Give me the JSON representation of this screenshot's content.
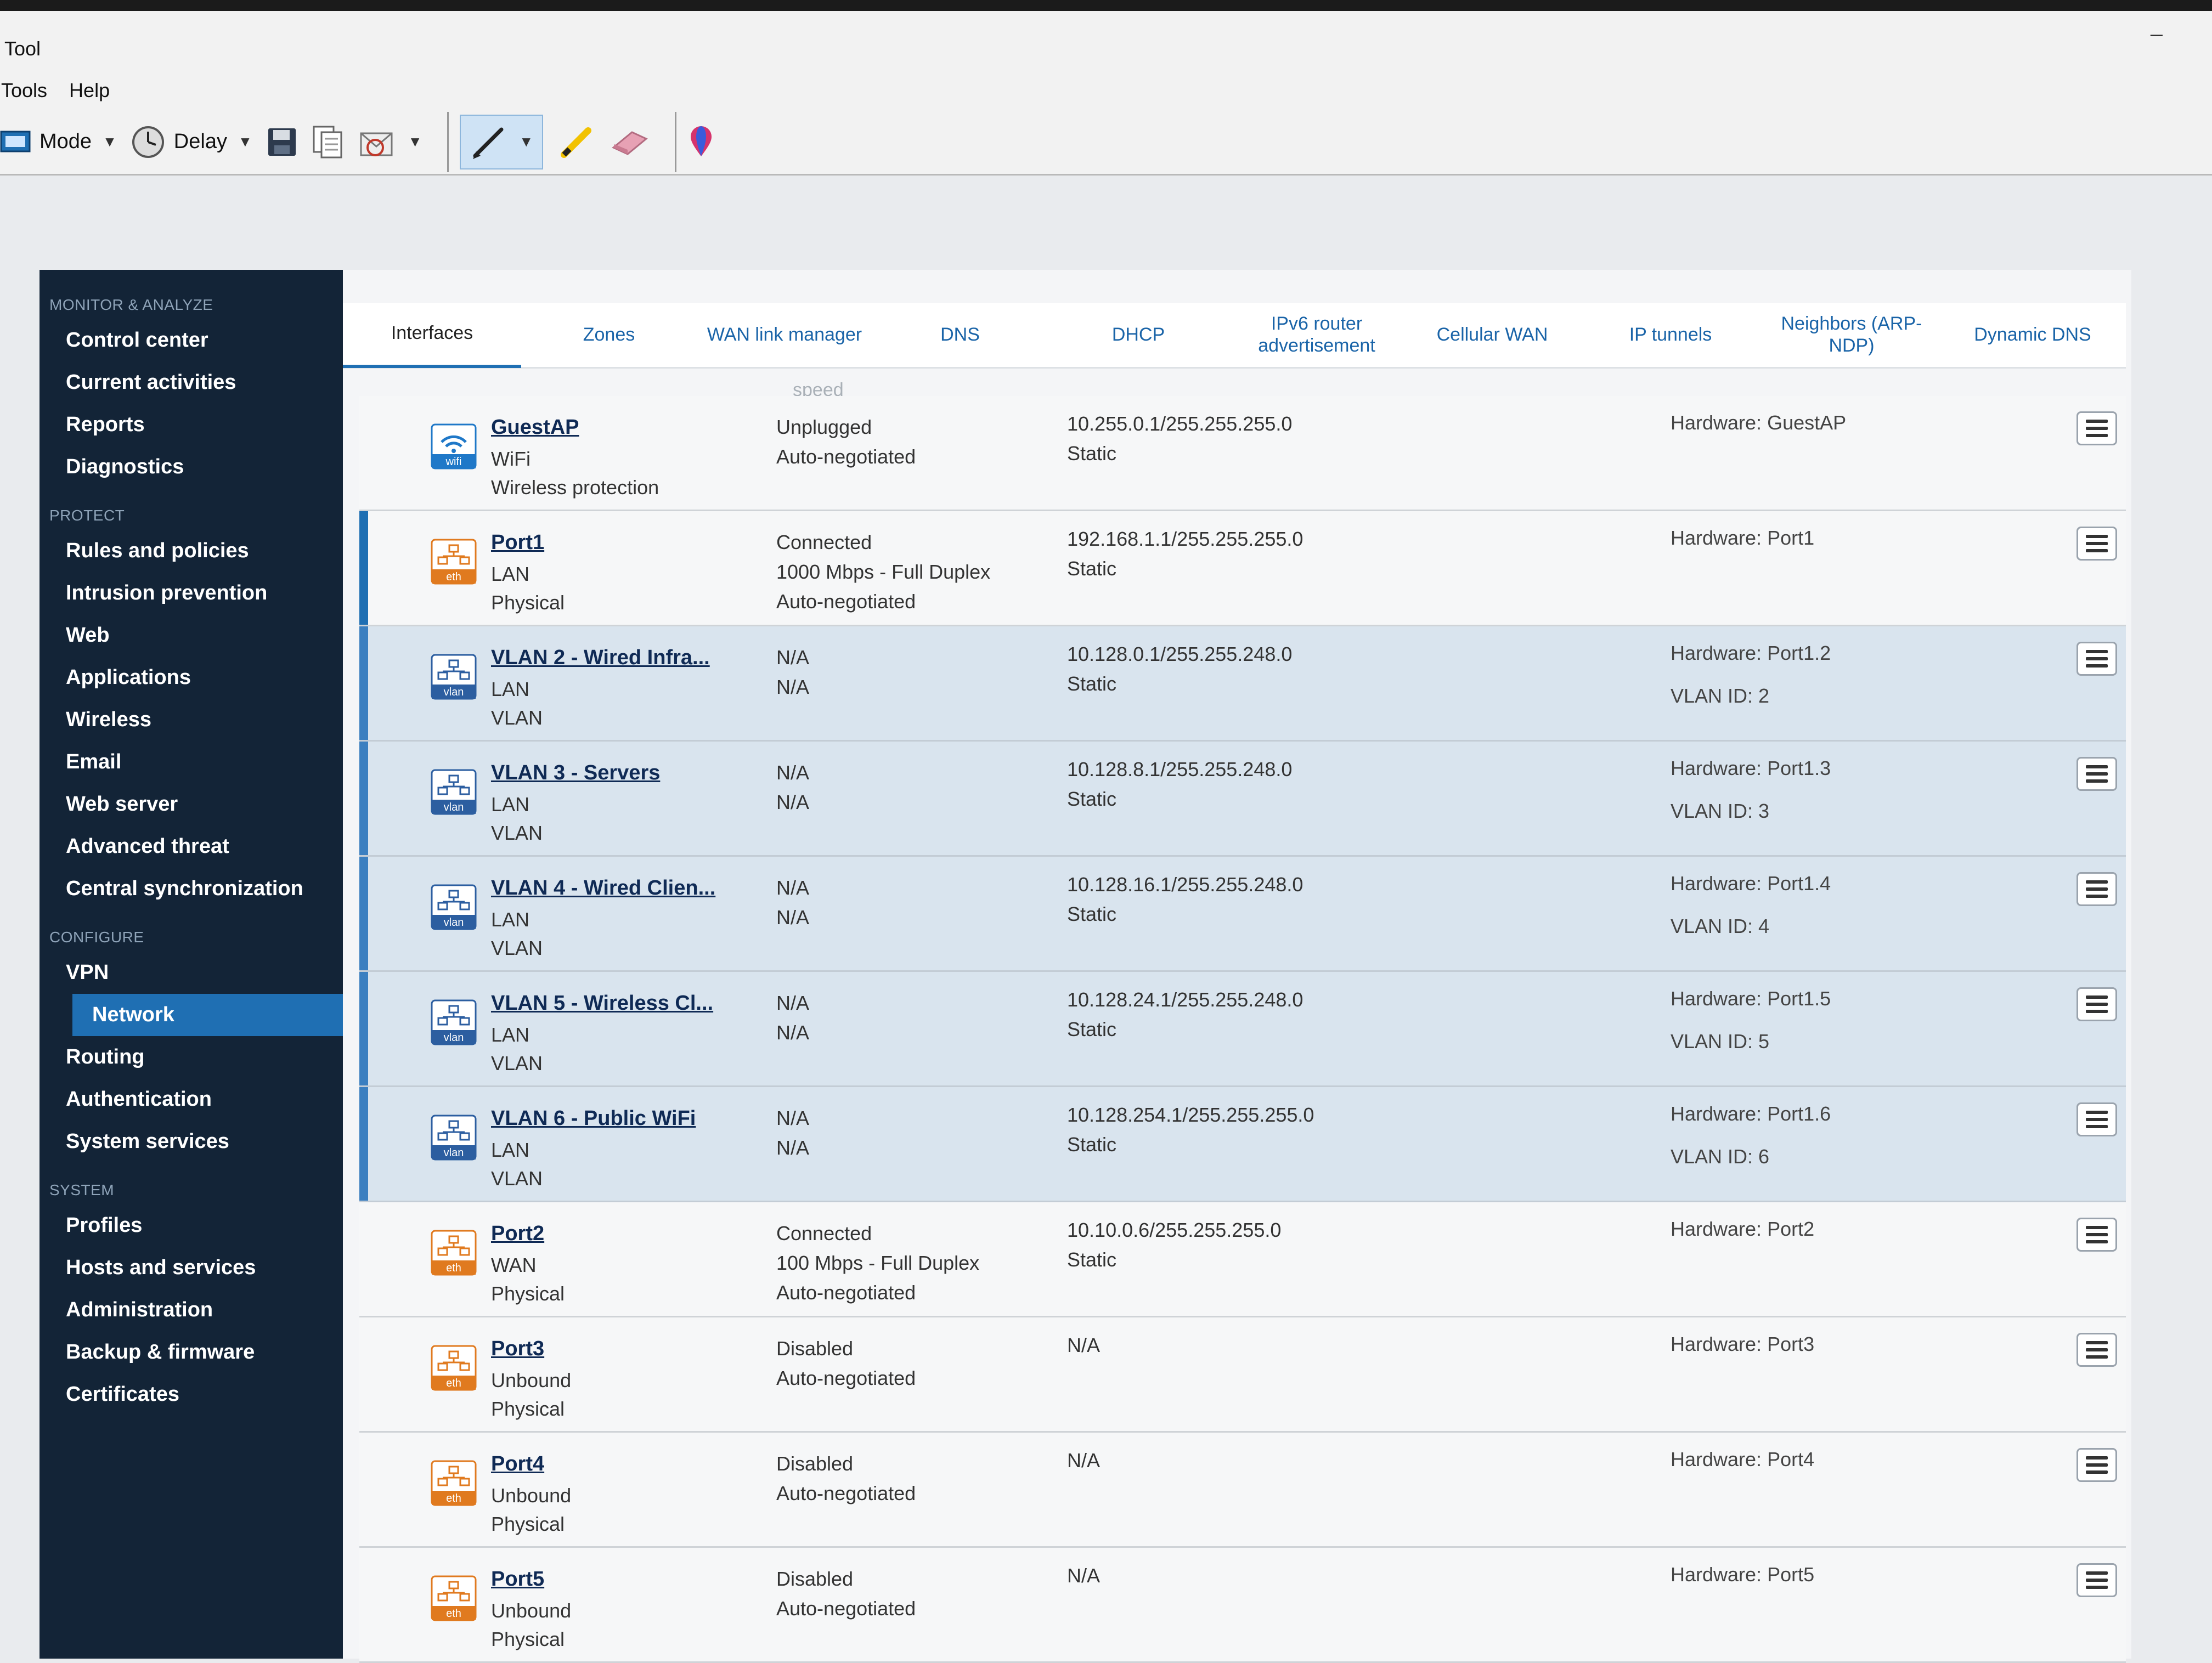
{
  "window": {
    "title": "Tool",
    "minimize": "–"
  },
  "menubar": [
    "Tools",
    "Help"
  ],
  "toolbar": {
    "mode_label": "Mode",
    "delay_label": "Delay"
  },
  "sidebar": {
    "sections": [
      {
        "title": "MONITOR & ANALYZE",
        "items": [
          "Control center",
          "Current activities",
          "Reports",
          "Diagnostics"
        ]
      },
      {
        "title": "PROTECT",
        "items": [
          "Rules and policies",
          "Intrusion prevention",
          "Web",
          "Applications",
          "Wireless",
          "Email",
          "Web server",
          "Advanced threat",
          "Central synchronization"
        ]
      },
      {
        "title": "CONFIGURE",
        "items": [
          "VPN",
          "Network",
          "Routing",
          "Authentication",
          "System services"
        ]
      },
      {
        "title": "SYSTEM",
        "items": [
          "Profiles",
          "Hosts and services",
          "Administration",
          "Backup & firmware",
          "Certificates"
        ]
      }
    ],
    "active": "Network"
  },
  "tabs": [
    "Interfaces",
    "Zones",
    "WAN link manager",
    "DNS",
    "DHCP",
    "IPv6 router advertisement",
    "Cellular WAN",
    "IP tunnels",
    "Neighbors (ARP-NDP)",
    "Dynamic DNS"
  ],
  "active_tab": "Interfaces",
  "column_hint": "speed",
  "interfaces": [
    {
      "icon": "wifi",
      "name": "GuestAP",
      "zone": "WiFi",
      "type": "Wireless protection",
      "status": [
        "Unplugged",
        "Auto-negotiated"
      ],
      "ip": [
        "10.255.0.1/255.255.255.0",
        "Static"
      ],
      "hardware": "Hardware:  GuestAP",
      "vlan_id": ""
    },
    {
      "icon": "eth",
      "name": "Port1",
      "zone": "LAN",
      "type": "Physical",
      "status": [
        "Connected",
        "1000 Mbps - Full Duplex",
        "Auto-negotiated"
      ],
      "ip": [
        "192.168.1.1/255.255.255.0",
        "Static"
      ],
      "hardware": "Hardware:  Port1",
      "vlan_id": ""
    },
    {
      "icon": "vlan",
      "name": "VLAN 2 - Wired Infra...",
      "zone": "LAN",
      "type": "VLAN",
      "status": [
        "N/A",
        "N/A"
      ],
      "ip": [
        "10.128.0.1/255.255.248.0",
        "Static"
      ],
      "hardware": "Hardware:  Port1.2",
      "vlan_id": "VLAN ID: 2"
    },
    {
      "icon": "vlan",
      "name": "VLAN 3 - Servers",
      "zone": "LAN",
      "type": "VLAN",
      "status": [
        "N/A",
        "N/A"
      ],
      "ip": [
        "10.128.8.1/255.255.248.0",
        "Static"
      ],
      "hardware": "Hardware:  Port1.3",
      "vlan_id": "VLAN ID: 3"
    },
    {
      "icon": "vlan",
      "name": "VLAN 4 - Wired Clien...",
      "zone": "LAN",
      "type": "VLAN",
      "status": [
        "N/A",
        "N/A"
      ],
      "ip": [
        "10.128.16.1/255.255.248.0",
        "Static"
      ],
      "hardware": "Hardware:  Port1.4",
      "vlan_id": "VLAN ID: 4"
    },
    {
      "icon": "vlan",
      "name": "VLAN 5 - Wireless Cl...",
      "zone": "LAN",
      "type": "VLAN",
      "status": [
        "N/A",
        "N/A"
      ],
      "ip": [
        "10.128.24.1/255.255.248.0",
        "Static"
      ],
      "hardware": "Hardware:  Port1.5",
      "vlan_id": "VLAN ID: 5"
    },
    {
      "icon": "vlan",
      "name": "VLAN 6 - Public WiFi",
      "zone": "LAN",
      "type": "VLAN",
      "status": [
        "N/A",
        "N/A"
      ],
      "ip": [
        "10.128.254.1/255.255.255.0",
        "Static"
      ],
      "hardware": "Hardware:  Port1.6",
      "vlan_id": "VLAN ID: 6"
    },
    {
      "icon": "eth",
      "name": "Port2",
      "zone": "WAN",
      "type": "Physical",
      "status": [
        "Connected",
        "100 Mbps - Full Duplex",
        "Auto-negotiated"
      ],
      "ip": [
        "10.10.0.6/255.255.255.0",
        "Static"
      ],
      "hardware": "Hardware:  Port2",
      "vlan_id": ""
    },
    {
      "icon": "eth",
      "name": "Port3",
      "zone": "Unbound",
      "type": "Physical",
      "status": [
        "Disabled",
        "Auto-negotiated"
      ],
      "ip": [
        "N/A"
      ],
      "hardware": "Hardware:  Port3",
      "vlan_id": ""
    },
    {
      "icon": "eth",
      "name": "Port4",
      "zone": "Unbound",
      "type": "Physical",
      "status": [
        "Disabled",
        "Auto-negotiated"
      ],
      "ip": [
        "N/A"
      ],
      "hardware": "Hardware:  Port4",
      "vlan_id": ""
    },
    {
      "icon": "eth",
      "name": "Port5",
      "zone": "Unbound",
      "type": "Physical",
      "status": [
        "Disabled",
        "Auto-negotiated"
      ],
      "ip": [
        "N/A"
      ],
      "hardware": "Hardware:  Port5",
      "vlan_id": ""
    }
  ],
  "colors": {
    "sidebar_bg": "#132437",
    "active_bg": "#1f6fb3",
    "vlan_row_bg": "#d9e4ee",
    "eth_icon": "#e07a1f",
    "vlan_icon": "#2c5ea0",
    "wifi_icon": "#1f78c8",
    "tab_link": "#1a64a8"
  }
}
